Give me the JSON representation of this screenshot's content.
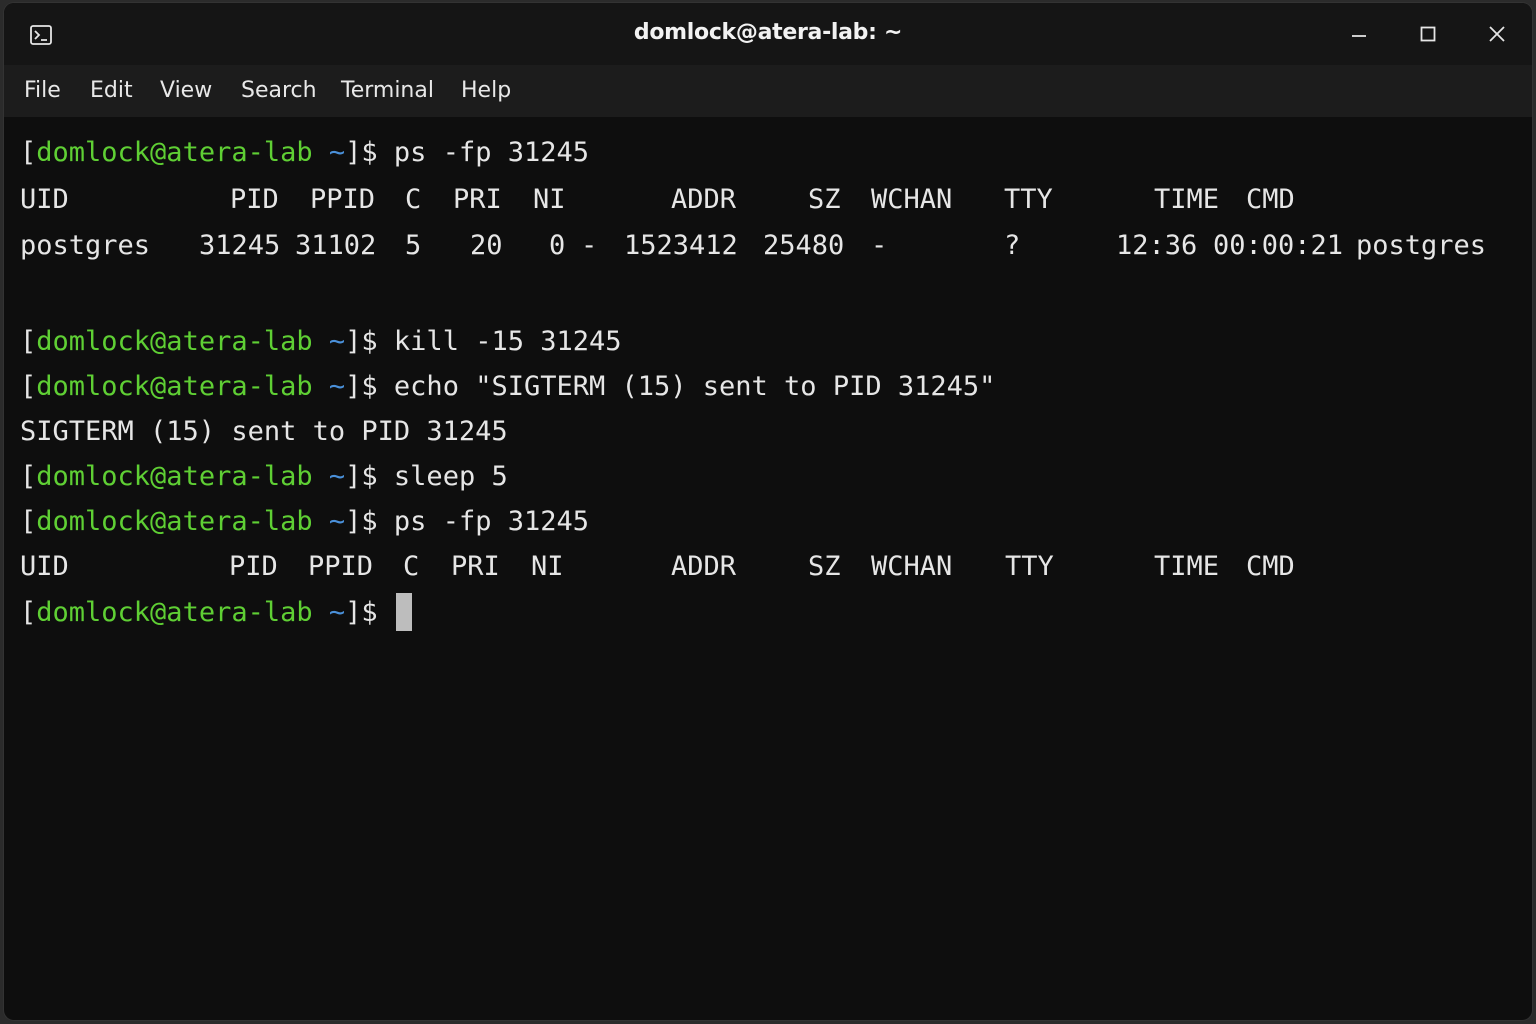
{
  "window": {
    "title": "domlock@atera-lab: ~"
  },
  "menu": {
    "items": [
      "File",
      "Edit",
      "View",
      "Search",
      "Terminal",
      "Help"
    ]
  },
  "prompt": {
    "open_bracket": "[",
    "user_host": "domlock@atera-lab",
    "path": "~",
    "suffix": "]$"
  },
  "commands": {
    "ps1": "ps -fp 31245",
    "kill": "kill -15 31245",
    "echo": "echo \"SIGTERM (15) sent to PID 31245\"",
    "sleep": "sleep 5",
    "ps2": "ps -fp 31245"
  },
  "ps_header": {
    "uid": "UID",
    "pid": "PID",
    "ppid": "PPID",
    "c": "C",
    "pri": "PRI",
    "ni": "NI",
    "addr": "ADDR",
    "sz": "SZ",
    "wchan": "WCHAN",
    "tty": "TTY",
    "time": "TIME",
    "cmd": "CMD"
  },
  "ps_row": {
    "uid": "postgres",
    "pid": "31245",
    "ppid": "31102",
    "c": "5",
    "pri": "20",
    "ni": "0",
    "dash": "-",
    "addr": "1523412",
    "sz": "25480",
    "wchan": "-",
    "tty": "?",
    "stime": "12:36",
    "time": "00:00:21",
    "cmd": "postgres"
  },
  "echo_output": "SIGTERM (15) sent to PID 31245",
  "colors": {
    "user_host": "#5fcf34",
    "path": "#4a90d9",
    "text": "#e6e6e6",
    "background": "#0e0e0e"
  }
}
